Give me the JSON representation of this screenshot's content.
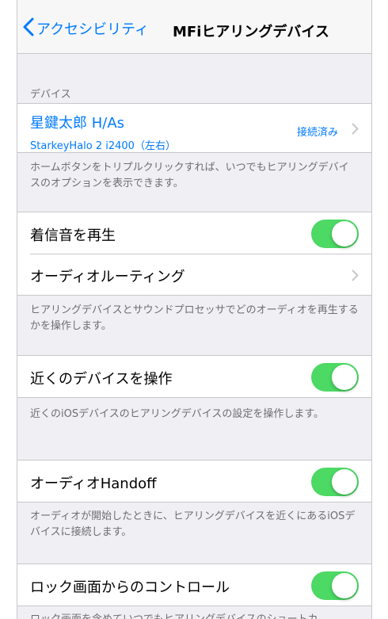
{
  "nav": {
    "back_label": "アクセシビリティ",
    "title": "MFiヒアリングデバイス"
  },
  "devices_section": {
    "header": "デバイス",
    "device": {
      "name": "星鍵太郎 H/As",
      "model": "StarkeyHalo 2 i2400（左右）",
      "status": "接続済み"
    },
    "footer": "ホームボタンをトリプルクリックすれば、いつでもヒアリングデバイスのオプションを表示できます。"
  },
  "audio_section": {
    "ringtone_label": "着信音を再生",
    "ringtone_on": true,
    "routing_label": "オーディオルーティング",
    "footer": "ヒアリングデバイスとサウンドプロセッサでどのオーディオを再生するかを操作します。"
  },
  "nearby_section": {
    "label": "近くのデバイスを操作",
    "on": true,
    "footer": "近くのiOSデバイスのヒアリングデバイスの設定を操作します。"
  },
  "handoff_section": {
    "label": "オーディオHandoff",
    "on": true,
    "footer": "オーディオが開始したときに、ヒアリングデバイスを近くにあるiOSデバイスに接続します。"
  },
  "lockscreen_section": {
    "label": "ロック画面からのコントロール",
    "on": true,
    "footer": "ロック画面を含めていつでもヒアリングデバイスのショートカ"
  },
  "colors": {
    "accent": "#007aff",
    "toggle_on": "#4cd964",
    "background": "#efeff4"
  }
}
